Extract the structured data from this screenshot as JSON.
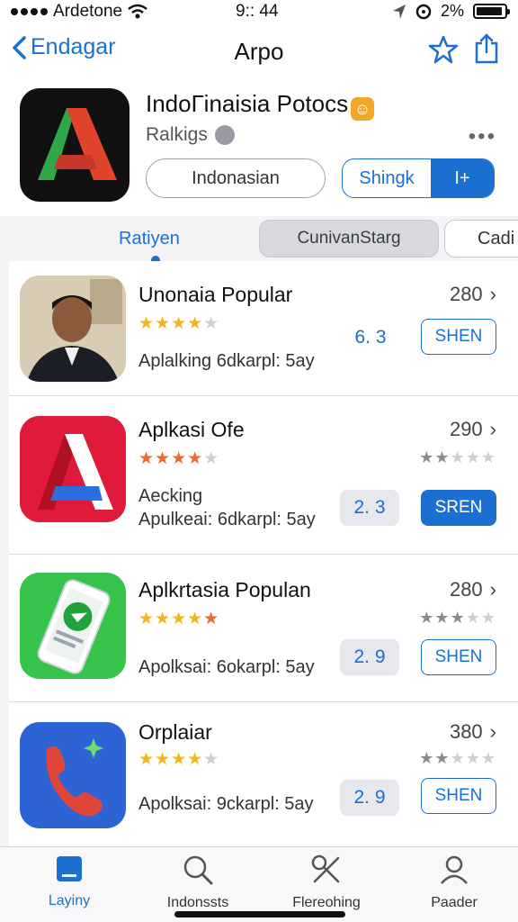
{
  "status_bar": {
    "carrier": "Ardetone",
    "time": "9:: 44",
    "battery": "2%"
  },
  "nav": {
    "back_label": "Endagar",
    "title": "Arpo"
  },
  "app": {
    "name": "IndoГinaisia Potocs",
    "subtitle": "Ralkigs",
    "more": "•••",
    "language_button": "Indonasian",
    "segment_left": "Shingk",
    "segment_right": "I+"
  },
  "tabs": {
    "tab1": "Ratiyen",
    "tab2": "CunivanStarg",
    "tab3": "Cadi"
  },
  "apps": [
    {
      "name": "Unonaia Popular",
      "desc_line1": "",
      "desc_line2": "Aplalking 6dkarpl: 5ay",
      "count": "280",
      "score": "6. 3",
      "get": "SHEN"
    },
    {
      "name": "Aplkasi Ofe",
      "desc_line1": "Aecking",
      "desc_line2": "Apulkeai: 6dkarpl: 5ay",
      "count": "290",
      "score": "2. 3",
      "get": "SREN"
    },
    {
      "name": "Aplkrtasia Populan",
      "desc_line1": "",
      "desc_line2": "Apolksai: 6okarpl: 5ay",
      "count": "280",
      "score": "2. 9",
      "get": "SHEN"
    },
    {
      "name": "Orplaiar",
      "desc_line1": "",
      "desc_line2": "Apolksai: 9ckarpl: 5ay",
      "count": "380",
      "score": "2. 9",
      "get": "SHEN"
    }
  ],
  "tab_bar": [
    {
      "label": "Layiny",
      "icon": "square-icon"
    },
    {
      "label": "Indonssts",
      "icon": "search-icon"
    },
    {
      "label": "Flereohing",
      "icon": "tools-icon"
    },
    {
      "label": "Paader",
      "icon": "person-icon"
    }
  ],
  "colors": {
    "accent": "#1a6fd0",
    "star_gold": "#f2b51b",
    "star_orange": "#ec6a2c"
  }
}
